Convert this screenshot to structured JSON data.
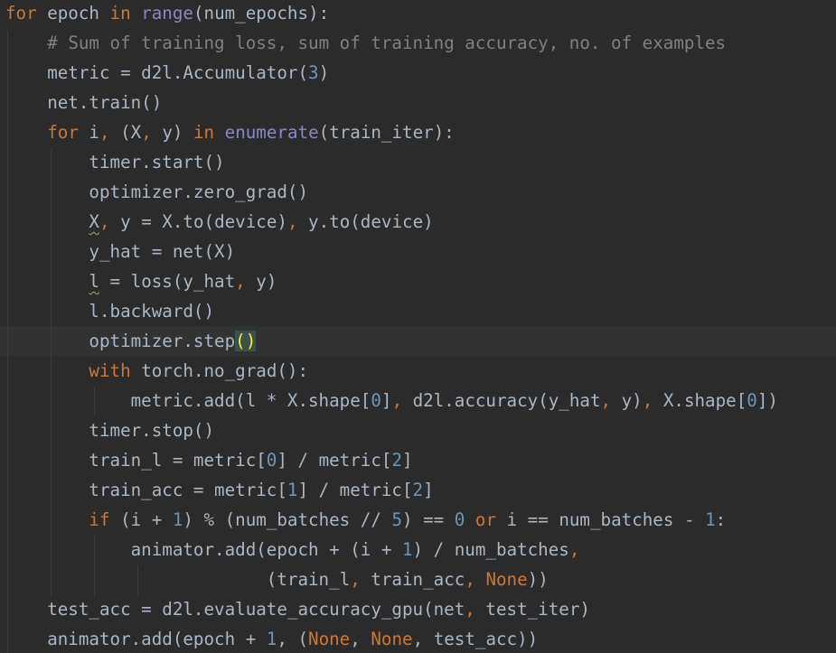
{
  "editor": {
    "lines": [
      [
        {
          "t": "for",
          "c": "kw"
        },
        {
          "t": " epoch "
        },
        {
          "t": "in",
          "c": "kw"
        },
        {
          "t": " "
        },
        {
          "t": "range",
          "c": "bi"
        },
        {
          "t": "(num_epochs):"
        }
      ],
      [
        {
          "t": "    "
        },
        {
          "t": "# Sum of training loss, sum of training accuracy, no. of examples",
          "c": "cmt"
        }
      ],
      [
        {
          "t": "    metric = d2l.Accumulator("
        },
        {
          "t": "3",
          "c": "num"
        },
        {
          "t": ")"
        }
      ],
      [
        {
          "t": "    net.train()"
        }
      ],
      [
        {
          "t": "    "
        },
        {
          "t": "for",
          "c": "kw"
        },
        {
          "t": " i"
        },
        {
          "t": ",",
          "c": "kw"
        },
        {
          "t": " (X"
        },
        {
          "t": ",",
          "c": "kw"
        },
        {
          "t": " y) "
        },
        {
          "t": "in",
          "c": "kw"
        },
        {
          "t": " "
        },
        {
          "t": "enumerate",
          "c": "bi"
        },
        {
          "t": "(train_iter):"
        }
      ],
      [
        {
          "t": "        timer.start()"
        }
      ],
      [
        {
          "t": "        optimizer.zero_grad()"
        }
      ],
      [
        {
          "t": "        "
        },
        {
          "t": "X",
          "c": "warn"
        },
        {
          "t": ",",
          "c": "kw"
        },
        {
          "t": " y = X.to(device)"
        },
        {
          "t": ",",
          "c": "kw"
        },
        {
          "t": " y.to(device)"
        }
      ],
      [
        {
          "t": "        y_hat = net(X)"
        }
      ],
      [
        {
          "t": "        "
        },
        {
          "t": "l",
          "c": "warn"
        },
        {
          "t": " = loss(y_hat"
        },
        {
          "t": ",",
          "c": "kw"
        },
        {
          "t": " y)"
        }
      ],
      [
        {
          "t": "        l.backward()"
        }
      ],
      [
        {
          "t": "        optimizer.step"
        },
        {
          "t": "()",
          "c": "brace-match"
        }
      ],
      [
        {
          "t": "        "
        },
        {
          "t": "with",
          "c": "kw"
        },
        {
          "t": " torch.no_grad():"
        }
      ],
      [
        {
          "t": "            metric.add(l * X.shape["
        },
        {
          "t": "0",
          "c": "num"
        },
        {
          "t": "]"
        },
        {
          "t": ",",
          "c": "kw"
        },
        {
          "t": " d2l.accuracy(y_hat"
        },
        {
          "t": ",",
          "c": "kw"
        },
        {
          "t": " y)"
        },
        {
          "t": ",",
          "c": "kw"
        },
        {
          "t": " X.shape["
        },
        {
          "t": "0",
          "c": "num"
        },
        {
          "t": "])"
        }
      ],
      [
        {
          "t": "        timer.stop()"
        }
      ],
      [
        {
          "t": "        train_l = metric["
        },
        {
          "t": "0",
          "c": "num"
        },
        {
          "t": "] / metric["
        },
        {
          "t": "2",
          "c": "num"
        },
        {
          "t": "]"
        }
      ],
      [
        {
          "t": "        train_acc = metric["
        },
        {
          "t": "1",
          "c": "num"
        },
        {
          "t": "] / metric["
        },
        {
          "t": "2",
          "c": "num"
        },
        {
          "t": "]"
        }
      ],
      [
        {
          "t": "        "
        },
        {
          "t": "if",
          "c": "kw"
        },
        {
          "t": " (i + "
        },
        {
          "t": "1",
          "c": "num"
        },
        {
          "t": ") % (num_batches // "
        },
        {
          "t": "5",
          "c": "num"
        },
        {
          "t": ") == "
        },
        {
          "t": "0",
          "c": "num"
        },
        {
          "t": " "
        },
        {
          "t": "or",
          "c": "kw"
        },
        {
          "t": " i == num_batches - "
        },
        {
          "t": "1",
          "c": "num"
        },
        {
          "t": ":"
        }
      ],
      [
        {
          "t": "            animator.add(epoch + (i + "
        },
        {
          "t": "1",
          "c": "num"
        },
        {
          "t": ") / num_batches"
        },
        {
          "t": ",",
          "c": "kw"
        }
      ],
      [
        {
          "t": "                         (train_l"
        },
        {
          "t": ",",
          "c": "kw"
        },
        {
          "t": " train_acc"
        },
        {
          "t": ",",
          "c": "kw"
        },
        {
          "t": " "
        },
        {
          "t": "None",
          "c": "kw"
        },
        {
          "t": "))"
        }
      ],
      [
        {
          "t": "    test_acc = d2l.evaluate_accuracy_gpu(net"
        },
        {
          "t": ",",
          "c": "kw"
        },
        {
          "t": " test_iter)"
        }
      ],
      [
        {
          "t": "    animator.add(epoch + "
        },
        {
          "t": "1",
          "c": "num"
        },
        {
          "t": ","
        },
        {
          "t": " ("
        },
        {
          "t": "None",
          "c": "kw"
        },
        {
          "t": ","
        },
        {
          "t": " "
        },
        {
          "t": "None",
          "c": "kw"
        },
        {
          "t": ","
        },
        {
          "t": " test_acc))"
        }
      ]
    ]
  },
  "colors": {
    "background": "#2b2b2b",
    "text": "#a9b7c6",
    "keyword": "#cc7832",
    "builtin": "#8888c6",
    "number": "#6897bb",
    "comment": "#808080",
    "caret_line": "#323232",
    "brace_match": "#ffef28"
  }
}
